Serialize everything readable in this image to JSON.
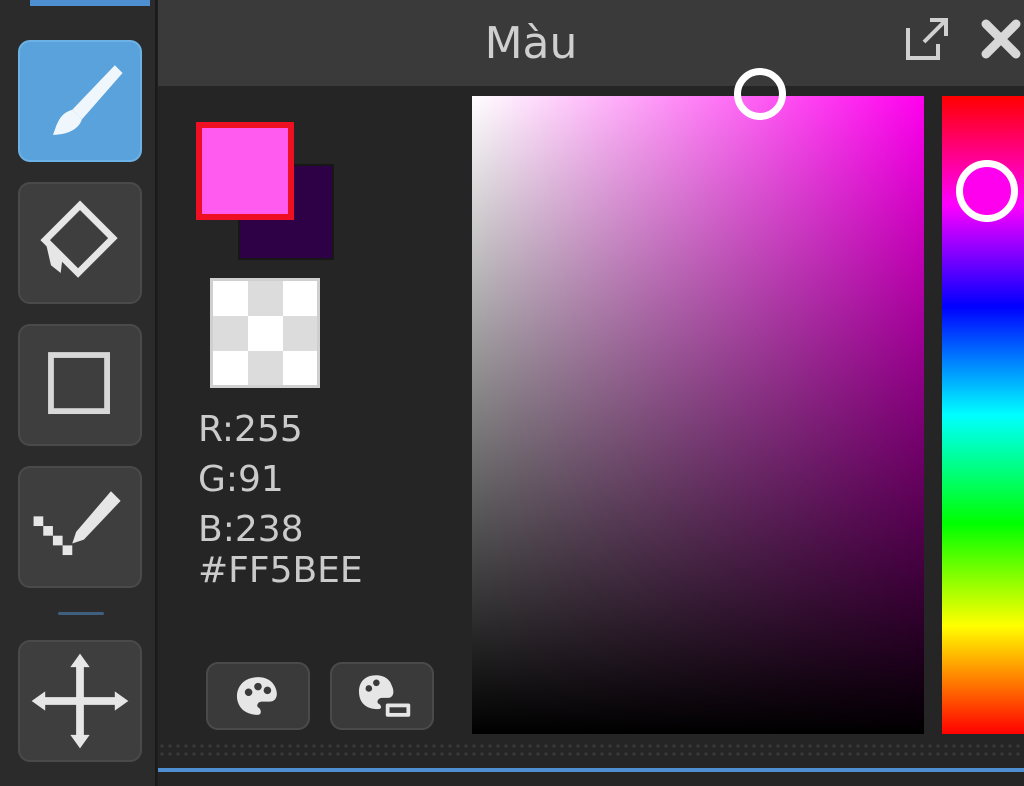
{
  "panel": {
    "title": "Màu"
  },
  "colors": {
    "foreground": "#ff5bee",
    "background": "#2e0046",
    "accent": "#5aa2db"
  },
  "readout": {
    "r": "R:255",
    "g": "G:91",
    "b": "B:238",
    "hex": "#FF5BEE"
  },
  "toolbar": {
    "tools": [
      {
        "icon": "brush-icon",
        "active": true
      },
      {
        "icon": "eraser-icon",
        "active": false
      },
      {
        "icon": "rectangle-icon",
        "active": false
      },
      {
        "icon": "pixel-pencil-icon",
        "active": false
      },
      {
        "icon": "move-icon",
        "active": false
      }
    ]
  },
  "buttons": {
    "palette": "palette-icon",
    "palette_settings": "palette-settings-icon"
  }
}
